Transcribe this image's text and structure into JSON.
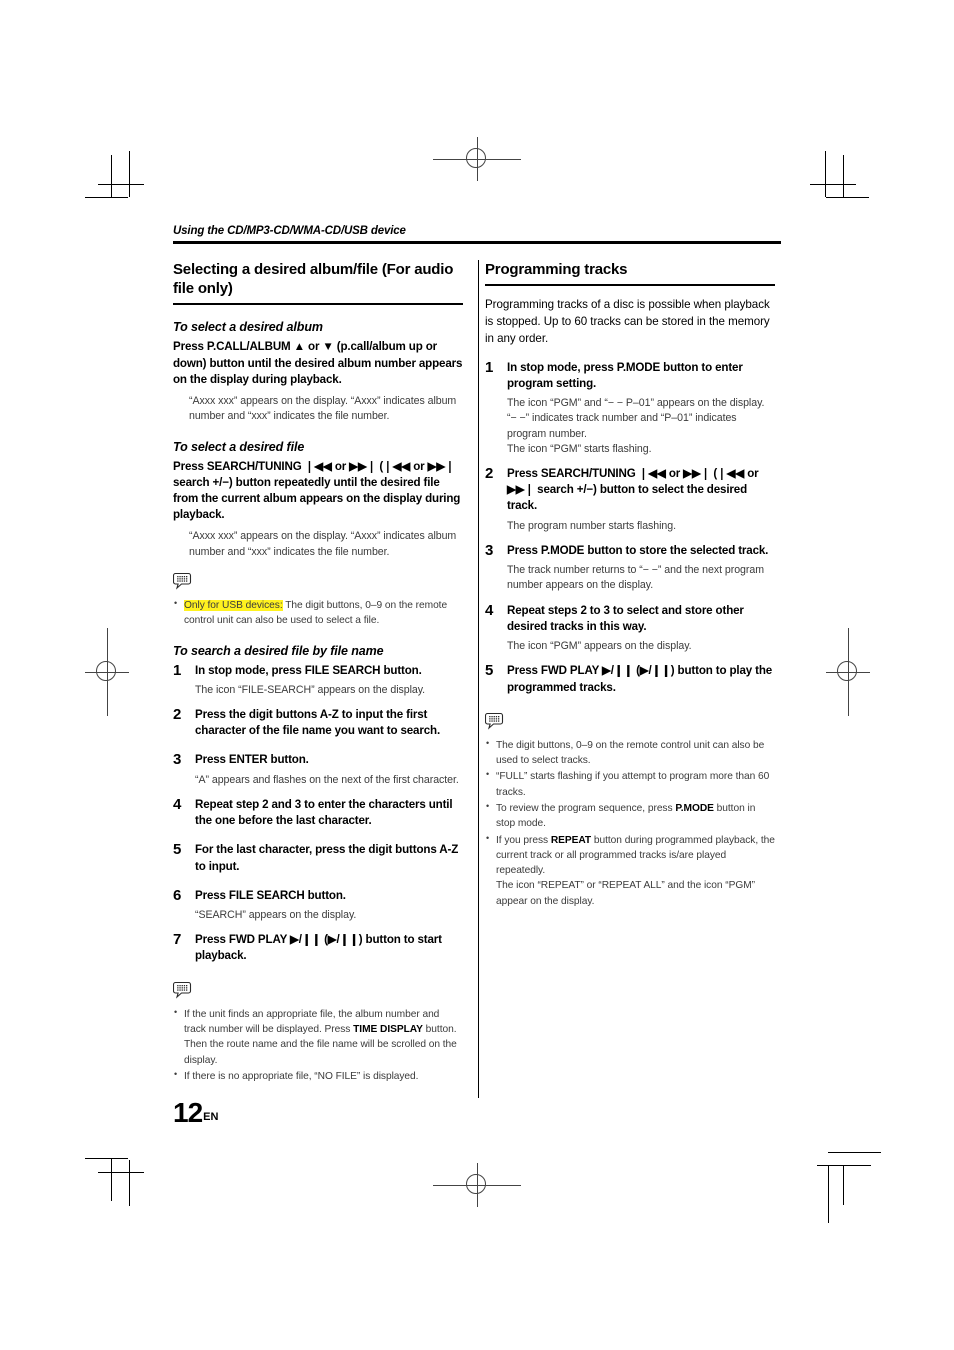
{
  "running_head": "Using the CD/MP3-CD/WMA-CD/USB device",
  "page_number": "12",
  "page_lang": "EN",
  "colors": {
    "highlight": "#fff21f",
    "rule": "#000000",
    "body_text": "#3b3b3b"
  },
  "left_column": {
    "section_title": "Selecting a desired album/file (For audio file only)",
    "sub1": {
      "title": "To select a desired album",
      "instruction": "Press P.CALL/ALBUM ▲ or ▼ (p.call/album up or down) button until the desired album number appears on the display during playback.",
      "detail": "“Axxx xxx” appears on the display. “Axxx” indicates album number and “xxx” indicates the file number."
    },
    "sub2": {
      "title": "To select a desired file",
      "instruction": "Press SEARCH/TUNING ❘◀◀ or ▶▶❘ (❘◀◀ or ▶▶❘ search +/−) button repeatedly until the desired file from the current album appears on the display during playback.",
      "detail": "“Axxx xxx” appears on the display. “Axxx” indicates album number and “xxx” indicates the file number.",
      "note_icon": "note-bubble-icon",
      "notes": [
        {
          "highlight": "Only for USB devices:",
          "text": " The digit buttons, 0–9 on the remote control unit can also be used to select a file."
        }
      ]
    },
    "sub3": {
      "title": "To search a desired file by file name",
      "steps": [
        {
          "num": "1",
          "instruction": "In stop mode, press FILE SEARCH button.",
          "detail": "The icon “FILE-SEARCH” appears on the display."
        },
        {
          "num": "2",
          "instruction": "Press the digit buttons A-Z to input the first character of the file name you want to search.",
          "detail": ""
        },
        {
          "num": "3",
          "instruction": "Press ENTER button.",
          "detail": "“A” appears and flashes on the next of the first character."
        },
        {
          "num": "4",
          "instruction": "Repeat step 2 and 3 to enter the characters until the one before the last character.",
          "detail": ""
        },
        {
          "num": "5",
          "instruction": "For the last character, press the digit buttons A-Z to input.",
          "detail": ""
        },
        {
          "num": "6",
          "instruction": "Press FILE SEARCH button.",
          "detail": "“SEARCH” appears on the display."
        },
        {
          "num": "7",
          "instruction": "Press FWD PLAY ▶/❙❙ (▶/❙❙) button to start playback.",
          "detail": ""
        }
      ],
      "note_icon": "note-bubble-icon",
      "notes": [
        {
          "pre": "If the unit finds an appropriate file, the album number and track number will be displayed. Press ",
          "bold": "TIME DISPLAY",
          "post": " button. Then the route name and the file name will be scrolled on the display."
        },
        {
          "pre": "If there is no appropriate file, “NO FILE” is displayed.",
          "bold": "",
          "post": ""
        }
      ]
    }
  },
  "right_column": {
    "section_title": "Programming tracks",
    "intro": "Programming tracks of a disc is possible when playback is stopped. Up to 60 tracks can be stored in the memory in any order.",
    "steps": [
      {
        "num": "1",
        "instruction": "In stop mode, press P.MODE button to enter program setting.",
        "detail": "The icon “PGM” and “− −  P–01” appears on the display. “− −” indicates track number and “P–01” indicates program number.",
        "detail2": "The icon “PGM” starts flashing."
      },
      {
        "num": "2",
        "instruction": "Press SEARCH/TUNING ❘◀◀ or ▶▶❘ (❘◀◀ or ▶▶❘ search +/−) button to select the desired track.",
        "detail": "The program number starts flashing.",
        "detail2": ""
      },
      {
        "num": "3",
        "instruction": "Press P.MODE button to store the selected track.",
        "detail": "The track number returns to “− −” and the next program number appears on the display.",
        "detail2": ""
      },
      {
        "num": "4",
        "instruction": "Repeat steps 2 to 3 to select and store other desired tracks in this way.",
        "detail": "The icon “PGM” appears on the display.",
        "detail2": ""
      },
      {
        "num": "5",
        "instruction": "Press FWD PLAY ▶/❙❙ (▶/❙❙) button to play the programmed tracks.",
        "detail": "",
        "detail2": ""
      }
    ],
    "note_icon": "note-bubble-icon",
    "notes": [
      {
        "pre": "The digit buttons, 0–9 on the remote control unit can also be used to select tracks.",
        "bold": "",
        "post": ""
      },
      {
        "pre": "“FULL” starts flashing if you attempt to program more than 60 tracks.",
        "bold": "",
        "post": ""
      },
      {
        "pre": "To review the program sequence, press ",
        "bold": "P.MODE",
        "post": " button in stop mode."
      },
      {
        "pre": "If you press ",
        "bold": "REPEAT",
        "post": " button during programmed playback, the current track or all programmed tracks is/are played repeatedly.",
        "post2": "The icon “REPEAT” or “REPEAT ALL” and the icon “PGM” appear on the display."
      }
    ]
  }
}
